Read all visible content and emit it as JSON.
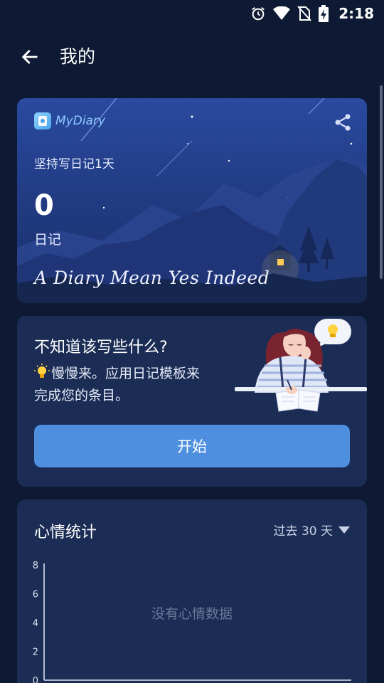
{
  "status_bar": {
    "time": "2:18",
    "icons": [
      "alarm-icon",
      "wifi-icon",
      "no-sim-icon",
      "battery-charging-icon"
    ]
  },
  "header": {
    "title": "我的",
    "back_icon": "arrow-left-icon"
  },
  "diary_card": {
    "brand": "MyDiary",
    "share_icon": "share-icon",
    "streak_text": "坚持写日记1天",
    "entry_count": "0",
    "entry_label": "日记",
    "tagline": "A Diary Mean Yes Indeed"
  },
  "tip_card": {
    "title": "不知道该写些什么?",
    "body": "慢慢来。应用日记模板来完成您的条目。",
    "start_label": "开始"
  },
  "mood_card": {
    "title": "心情统计",
    "range_label": "过去 30 天",
    "empty_message": "没有心情数据"
  },
  "chart_data": {
    "type": "line",
    "title": "",
    "y_ticks": [
      "8",
      "6",
      "4",
      "2",
      "0"
    ],
    "ylim": [
      0,
      8
    ],
    "series": []
  },
  "colors": {
    "background": "#0e1a33",
    "card": "#1b2c55",
    "accent": "#4f8fe0"
  }
}
